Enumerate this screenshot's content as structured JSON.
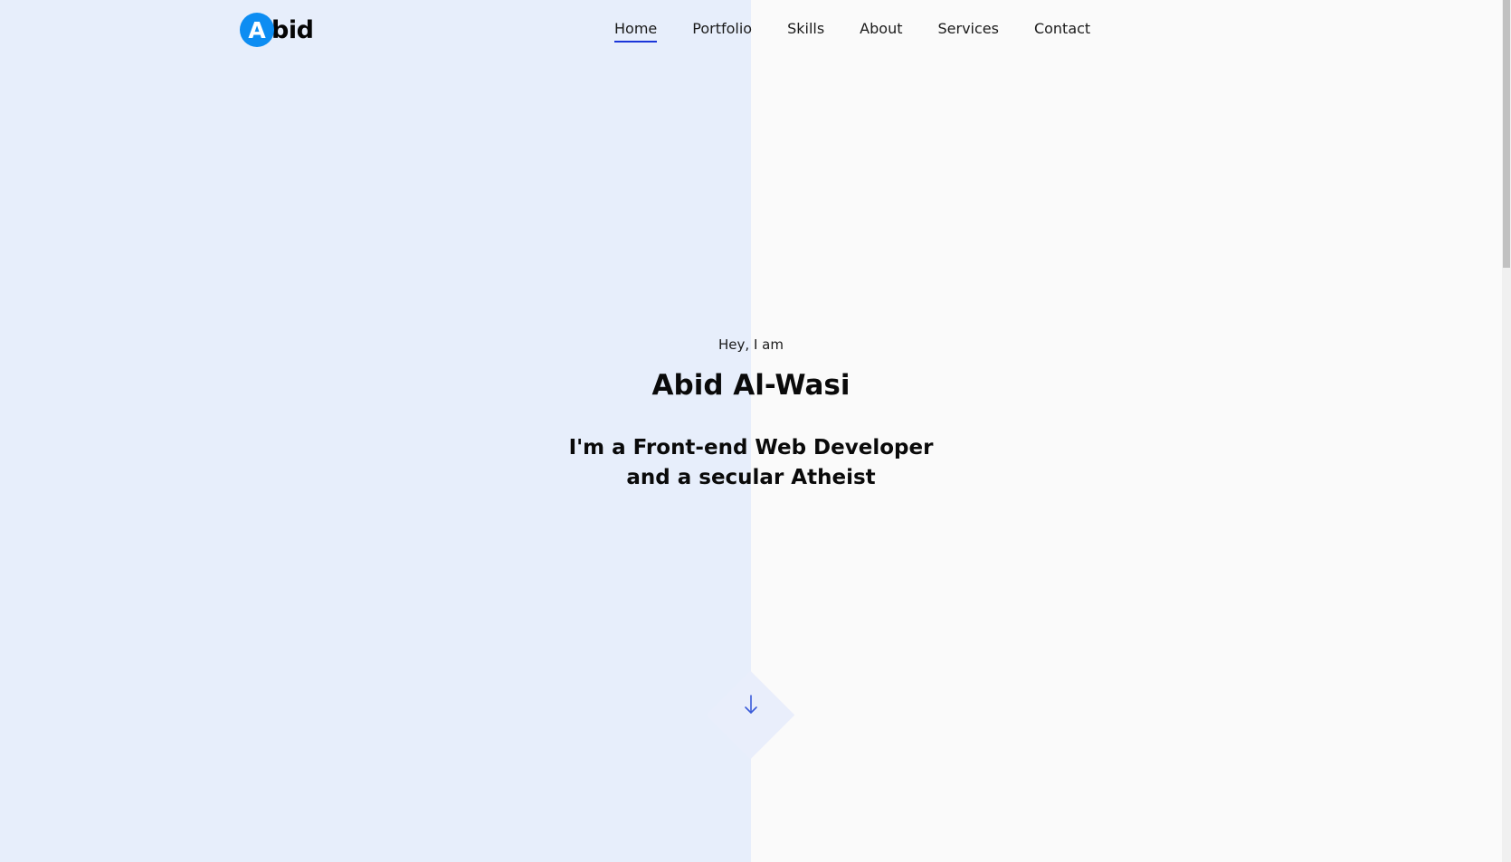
{
  "logo": {
    "letter": "A",
    "rest": "bid"
  },
  "nav": {
    "items": [
      {
        "label": "Home",
        "active": true
      },
      {
        "label": "Portfolio",
        "active": false
      },
      {
        "label": "Skills",
        "active": false
      },
      {
        "label": "About",
        "active": false
      },
      {
        "label": "Services",
        "active": false
      },
      {
        "label": "Contact",
        "active": false
      }
    ]
  },
  "hero": {
    "greeting": "Hey, I am",
    "name": "Abid Al-Wasi",
    "tagline": "I'm a Front-end Web Developer and a secular Atheist"
  },
  "scroll_button": {
    "icon": "arrow-down-icon"
  },
  "colors": {
    "accent": "#0d8df2",
    "nav_underline": "#1a35d9",
    "left_panel": "#e7eefb",
    "right_panel": "#fafafa",
    "arrow": "#3a5bd9"
  }
}
